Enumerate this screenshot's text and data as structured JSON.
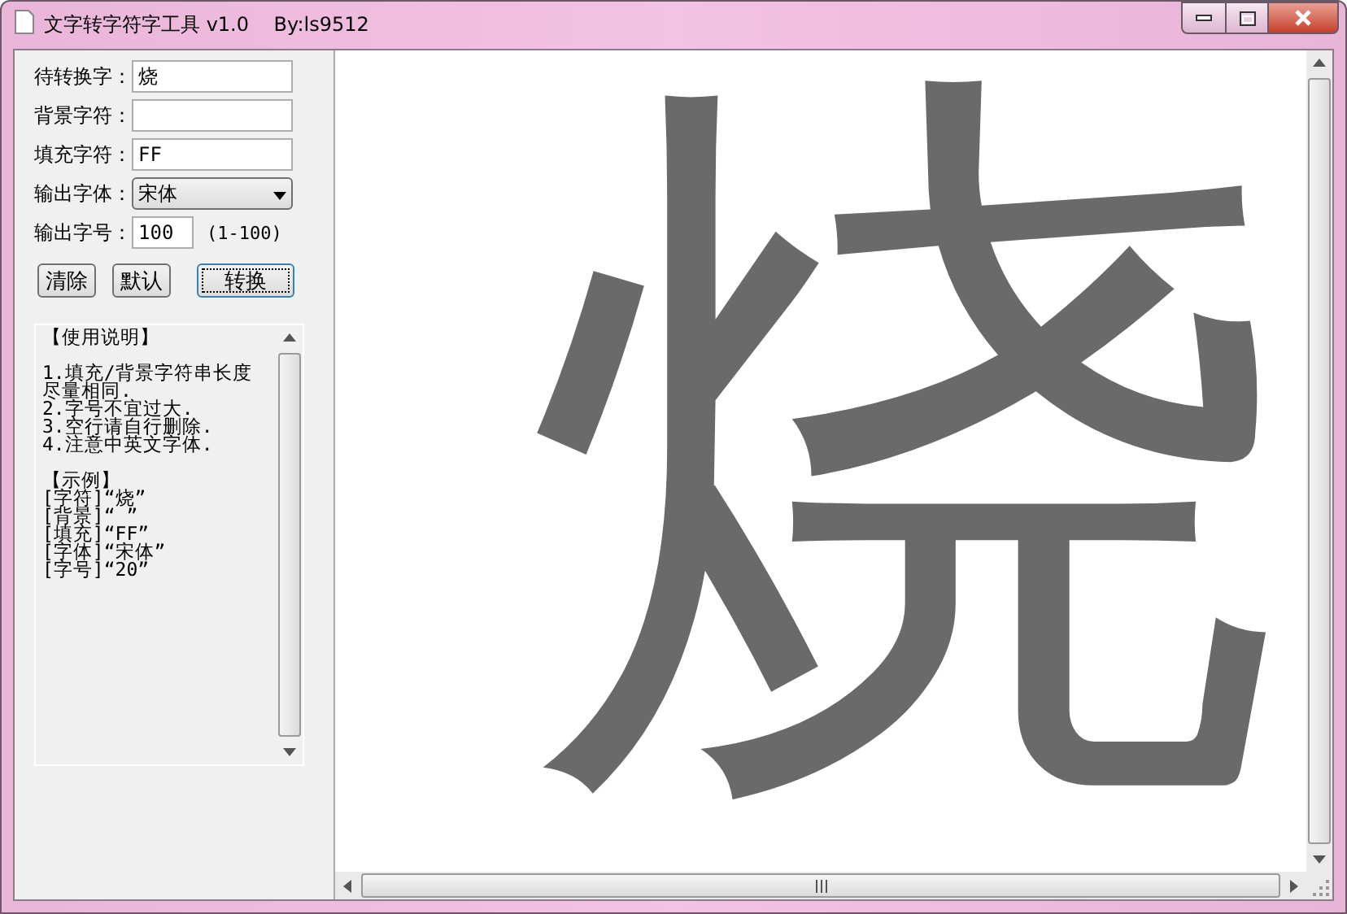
{
  "window": {
    "title": "文字转字符字工具 v1.0    By:ls9512"
  },
  "fields": [
    {
      "kind": "text",
      "label": "待转换字：",
      "value": "烧"
    },
    {
      "kind": "text",
      "label": "背景字符："
    },
    {
      "kind": "text",
      "label": "填充字符：",
      "value": "FF"
    },
    {
      "kind": "select",
      "label": "输出字体：",
      "value": "宋体"
    },
    {
      "kind": "number",
      "label": "输出字号：",
      "value": "100",
      "hint": "(1-100)"
    }
  ],
  "buttons": [
    {
      "label": "清除",
      "focused": false
    },
    {
      "label": "默认",
      "focused": false
    },
    {
      "label": "转换",
      "focused": true
    }
  ],
  "instructions": {
    "paragraphs": [
      [
        "【使用说明】"
      ],
      [
        "1.填充/背景字符串长度尽量相同.",
        "2.字号不宜过大.",
        "3.空行请自行删除.",
        "4.注意中英文字体."
      ],
      [
        "【示例】",
        "[字符]“烧”",
        "[背景]“ ”",
        "[填充]“FF”",
        "[字体]“宋体”",
        "[字号]“20”"
      ]
    ]
  },
  "output": {
    "art": "烧"
  }
}
